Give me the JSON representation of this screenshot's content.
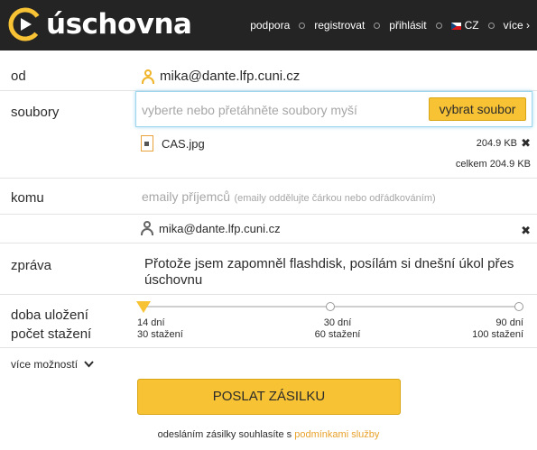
{
  "header": {
    "logo_text": "úschovna",
    "nav": {
      "support": "podpora",
      "register": "registrovat",
      "login": "přihlásit",
      "language": "CZ",
      "more": "více"
    }
  },
  "form": {
    "from": {
      "label": "od",
      "value": "mika@dante.lfp.cuni.cz"
    },
    "files": {
      "label": "soubory",
      "placeholder": "vyberte nebo přetáhněte soubory myší",
      "select_button": "vybrat soubor",
      "items": [
        {
          "name": "CAS.jpg",
          "size": "204.9 KB"
        }
      ],
      "total": "celkem 204.9 KB"
    },
    "to": {
      "label": "komu",
      "placeholder": "emaily příjemců",
      "hint": "(emaily oddělujte čárkou nebo odřádkováním)",
      "recipients": [
        "mika@dante.lfp.cuni.cz"
      ]
    },
    "message": {
      "label": "zpráva",
      "value": "Přotože jsem zapomněl flashdisk, posílám si dnešní úkol přes úschovnu"
    },
    "storage": {
      "label_line1": "doba uložení",
      "label_line2": "počet stažení",
      "selected_index": 0,
      "options": [
        {
          "days": "14 dní",
          "downloads": "30 stažení"
        },
        {
          "days": "30 dní",
          "downloads": "60 stažení"
        },
        {
          "days": "90 dní",
          "downloads": "100 stažení"
        }
      ]
    },
    "more_options": "více možností",
    "send_button": "POSLAT ZÁSILKU",
    "terms_prefix": "odesláním zásilky souhlasíte s",
    "terms_link": "podmínkami služby"
  },
  "colors": {
    "accent": "#f7c233",
    "header_bg": "#242424",
    "link": "#e8a12a",
    "focus": "#9fd6ef"
  }
}
